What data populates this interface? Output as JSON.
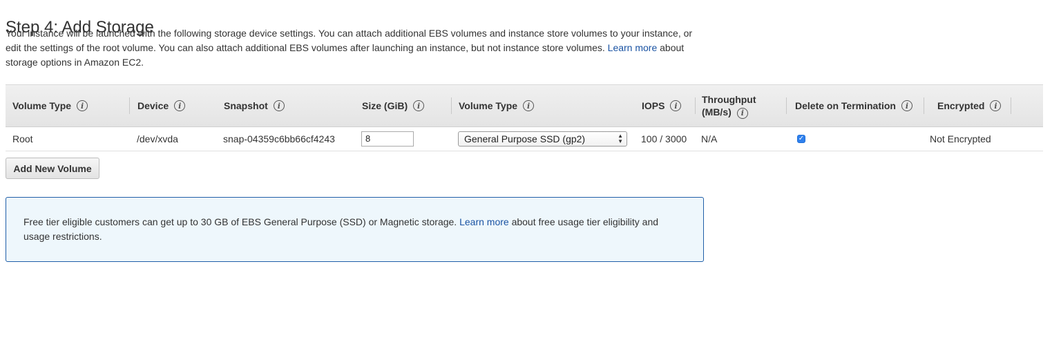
{
  "page": {
    "title": "Step 4: Add Storage",
    "intro": {
      "text_before_link": "Your instance will be launched with the following storage device settings. You can attach additional EBS volumes and instance store volumes to your instance, or edit the settings of the root volume. You can also attach additional EBS volumes after launching an instance, but not instance store volumes. ",
      "link": "Learn more",
      "text_after_link": " about storage options in Amazon EC2."
    }
  },
  "table": {
    "columns": [
      {
        "label": "Volume Type"
      },
      {
        "label": "Device"
      },
      {
        "label": "Snapshot"
      },
      {
        "label": "Size (GiB)"
      },
      {
        "label": "Volume Type"
      },
      {
        "label": "IOPS"
      },
      {
        "label_line1": "Throughput",
        "label_line2": "(MB/s)"
      },
      {
        "label": "Delete on Termination"
      },
      {
        "label": "Encrypted"
      }
    ],
    "rows": [
      {
        "volume_type": "Root",
        "device": "/dev/xvda",
        "snapshot": "snap-04359c6bb66cf4243",
        "size": "8",
        "ebs_volume_type": "General Purpose SSD (gp2)",
        "iops": "100 / 3000",
        "throughput": "N/A",
        "delete_on_termination": true,
        "encrypted": "Not Encrypted"
      }
    ]
  },
  "actions": {
    "add_volume_label": "Add New Volume"
  },
  "notice": {
    "text_before_link": "Free tier eligible customers can get up to 30 GB of EBS General Purpose (SSD) or Magnetic storage. ",
    "link": "Learn more",
    "text_after_link": " about free usage tier eligibility and usage restrictions."
  },
  "icons": {
    "info": "info-icon",
    "checkmark": "checkmark-icon",
    "select_arrows": "sort-arrows-icon"
  },
  "colors": {
    "link": "#1a53a3",
    "notice_border": "#1f5ea8",
    "notice_bg": "#eef7fc",
    "checkbox": "#2f80ed"
  }
}
